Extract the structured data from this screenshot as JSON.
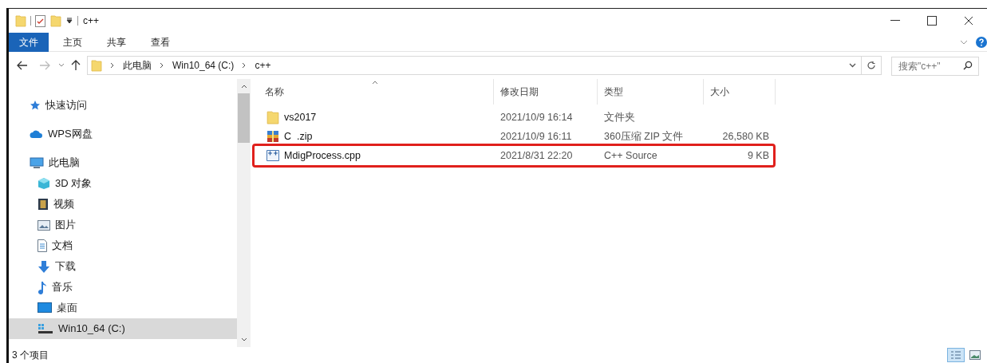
{
  "window": {
    "title": "c++"
  },
  "ribbon_tabs": [
    {
      "label": "文件",
      "selected": true
    },
    {
      "label": "主页",
      "selected": false
    },
    {
      "label": "共享",
      "selected": false
    },
    {
      "label": "查看",
      "selected": false
    }
  ],
  "address_bar": {
    "path": [
      "此电脑",
      "Win10_64 (C:)",
      "c++"
    ]
  },
  "search": {
    "placeholder": "搜索\"c++\""
  },
  "navigation": [
    {
      "label": "快速访问",
      "selected": false
    },
    {
      "label": "WPS网盘",
      "selected": false
    },
    {
      "label": "此电脑",
      "selected": false,
      "children": [
        {
          "label": "3D 对象",
          "selected": false
        },
        {
          "label": "视频",
          "selected": false
        },
        {
          "label": "图片",
          "selected": false
        },
        {
          "label": "文档",
          "selected": false
        },
        {
          "label": "下载",
          "selected": false
        },
        {
          "label": "音乐",
          "selected": false
        },
        {
          "label": "桌面",
          "selected": false
        },
        {
          "label": "Win10_64 (C:)",
          "selected": true
        }
      ]
    }
  ],
  "columns": [
    "名称",
    "修改日期",
    "类型",
    "大小"
  ],
  "files": [
    {
      "kind": "folder",
      "name": "vs2017",
      "modified": "2021/10/9 16:14",
      "type": "文件夹",
      "highlighted": false
    },
    {
      "kind": "zip",
      "name": "C  .zip",
      "modified": "2021/10/9 16:11",
      "type": "360压缩 ZIP 文件",
      "size": "26,580 KB",
      "highlighted": false
    },
    {
      "kind": "cpp",
      "name": "MdigProcess.cpp",
      "modified": "2021/8/31 22:20",
      "type": "C++ Source",
      "size": "9 KB",
      "highlighted": true
    }
  ],
  "status_bar": {
    "count": "3 个项目"
  }
}
